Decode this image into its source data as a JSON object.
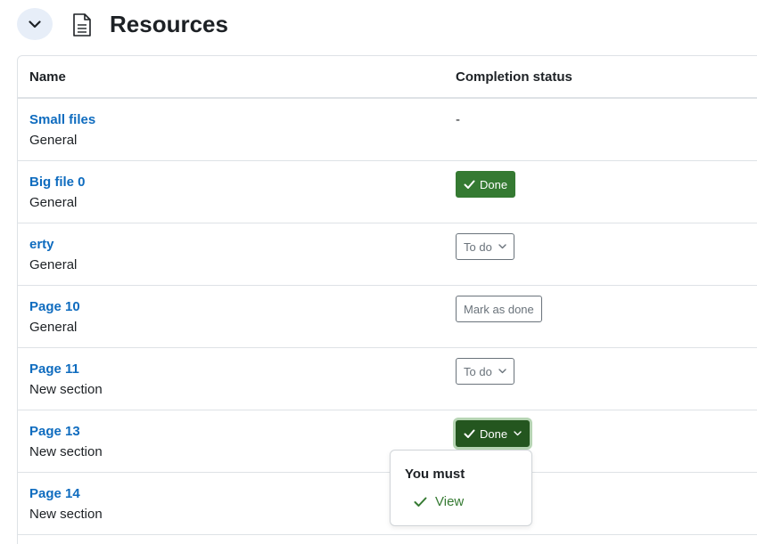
{
  "header": {
    "title": "Resources",
    "collapse_icon": "chevron-down-icon",
    "section_icon": "document-icon"
  },
  "table": {
    "columns": [
      "Name",
      "Completion status"
    ],
    "rows": [
      {
        "name": "Small files",
        "section": "General",
        "status": "-"
      },
      {
        "name": "Big file 0",
        "section": "General",
        "status": "Done"
      },
      {
        "name": "erty",
        "section": "General",
        "status": "To do"
      },
      {
        "name": "Page 10",
        "section": "General",
        "status": "Mark as done"
      },
      {
        "name": "Page 11",
        "section": "New section",
        "status": "To do"
      },
      {
        "name": "Page 13",
        "section": "New section",
        "status": "Done"
      },
      {
        "name": "Page 14",
        "section": "New section",
        "status": ""
      }
    ]
  },
  "popover": {
    "title": "You must",
    "items": [
      {
        "label": "View",
        "state": "complete"
      }
    ]
  },
  "colors": {
    "link": "#0f6cbf",
    "done_green": "#357a32",
    "done_active": "#24561f",
    "collapse_bg": "#e7eef8"
  }
}
